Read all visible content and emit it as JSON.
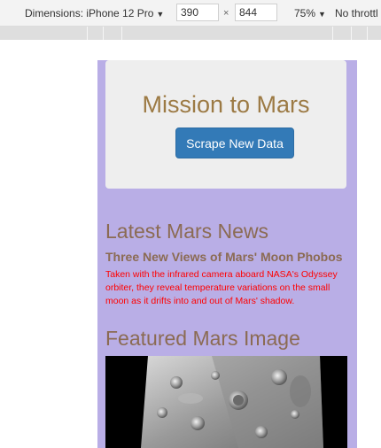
{
  "devtools": {
    "dimensions_label": "Dimensions: iPhone 12 Pro",
    "width": "390",
    "height": "844",
    "times_sign": "×",
    "zoom": "75%",
    "throttle": "No throttl"
  },
  "page": {
    "title": "Mission to Mars",
    "scrape_button": "Scrape New Data",
    "news_heading": "Latest Mars News",
    "news_title": "Three New Views of Mars' Moon Phobos",
    "news_paragraph": "Taken with the infrared camera aboard NASA's Odyssey orbiter, they reveal temperature variations on the small moon as it drifts into and out of Mars' shadow.",
    "featured_heading": "Featured Mars Image"
  },
  "colors": {
    "page_background": "#b9aee6",
    "jumbotron": "#eeeeee",
    "title": "#9c7a44",
    "heading": "#8b6b53",
    "paragraph": "#ff0000",
    "button": "#337ab7"
  }
}
